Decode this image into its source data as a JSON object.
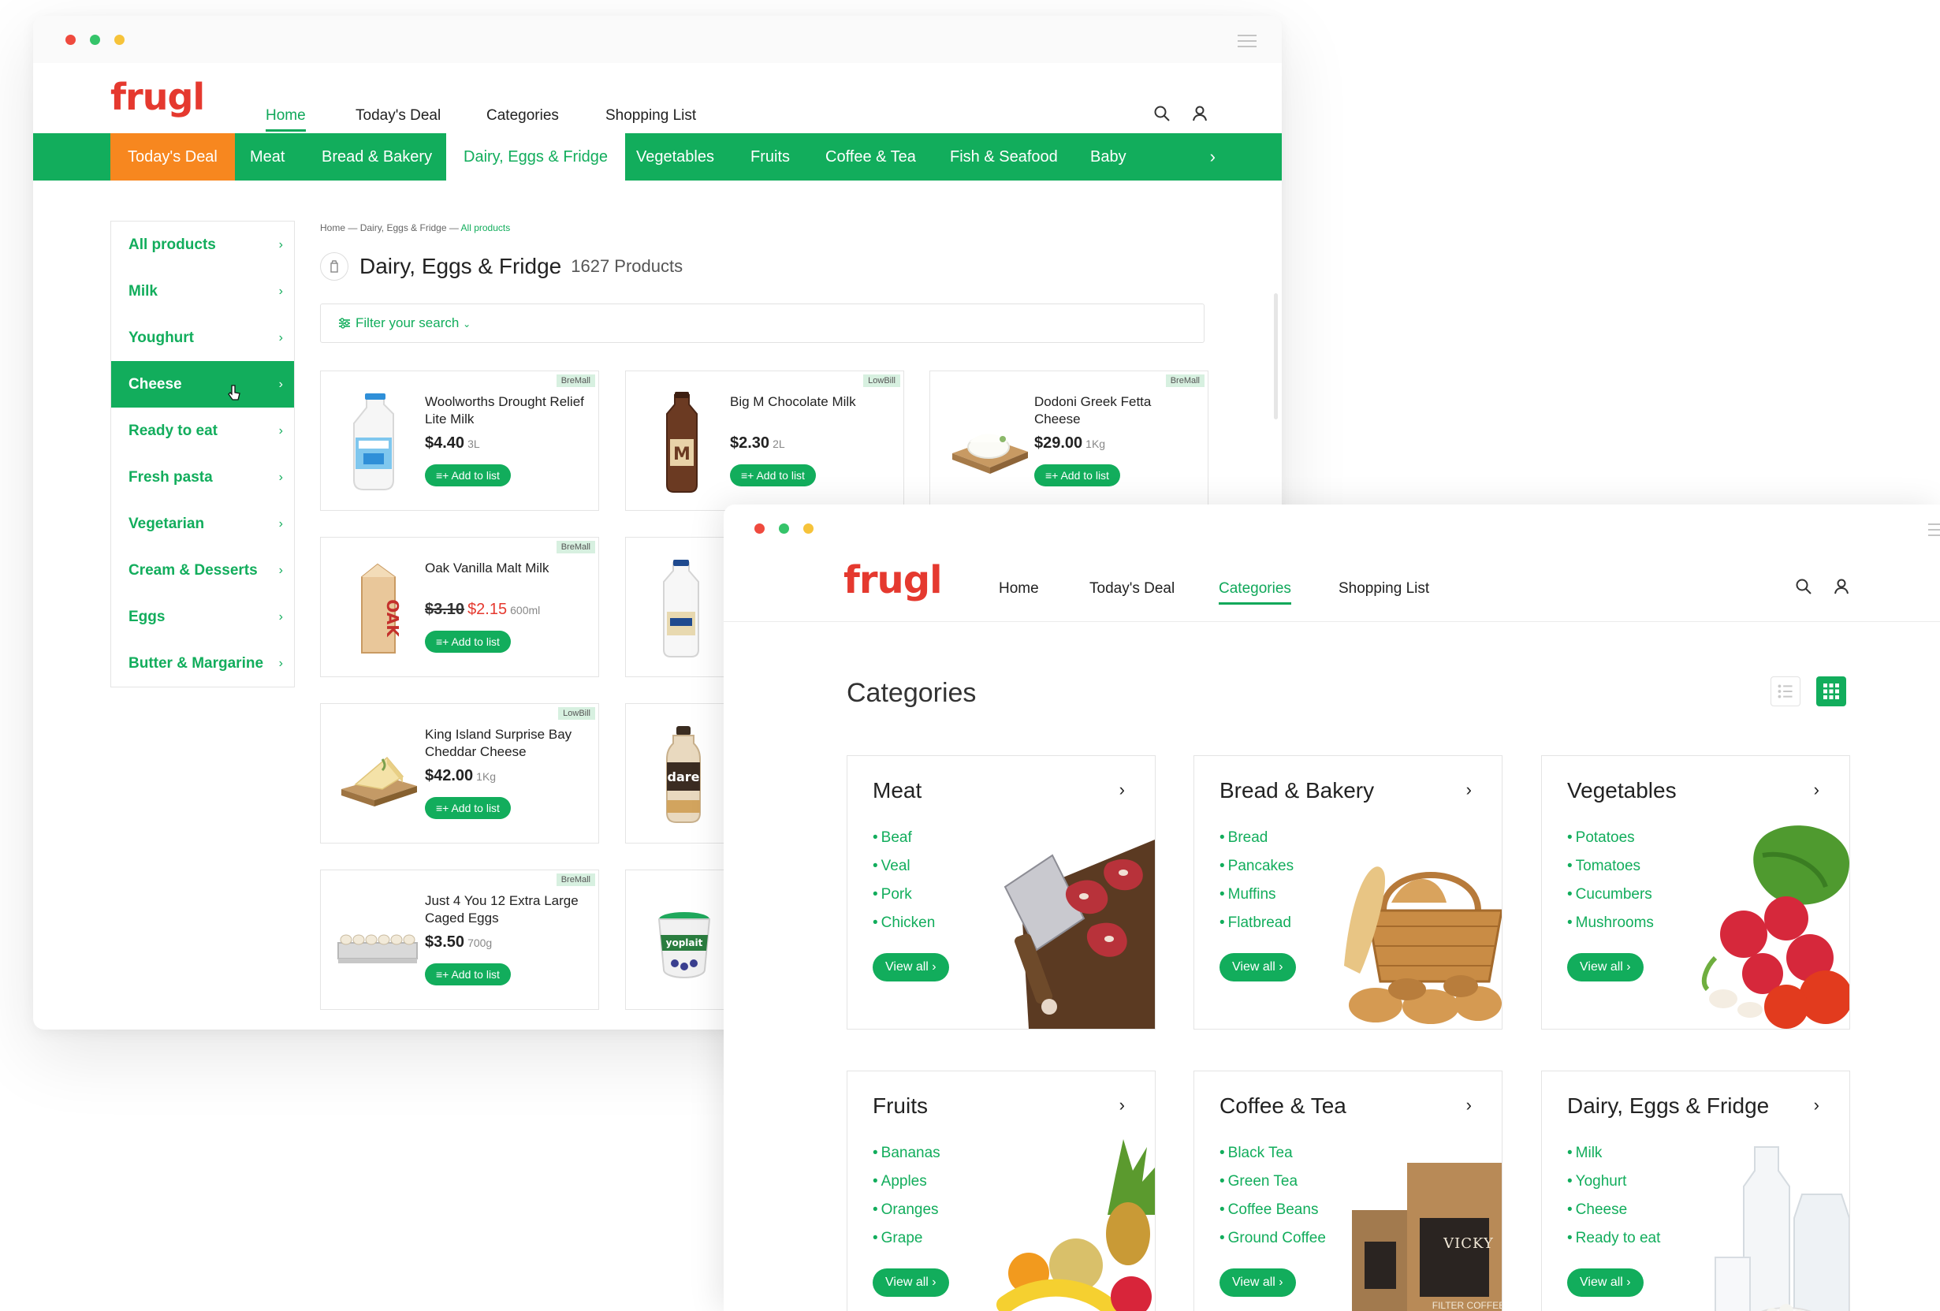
{
  "colors": {
    "brand_green": "#12ad5c",
    "deal_orange": "#f7871f",
    "logo_red": "#e5392f"
  },
  "back_window": {
    "logo": "frugl",
    "nav": [
      {
        "label": "Home",
        "active": true
      },
      {
        "label": "Today's Deal",
        "active": false
      },
      {
        "label": "Categories",
        "active": false
      },
      {
        "label": "Shopping List",
        "active": false
      }
    ],
    "category_bar": [
      {
        "label": "Today's Deal"
      },
      {
        "label": "Meat"
      },
      {
        "label": "Bread & Bakery"
      },
      {
        "label": "Dairy, Eggs & Fridge"
      },
      {
        "label": "Vegetables"
      },
      {
        "label": "Fruits"
      },
      {
        "label": "Coffee & Tea"
      },
      {
        "label": "Fish & Seafood"
      },
      {
        "label": "Baby"
      }
    ],
    "category_more": "›",
    "sidebar": [
      {
        "label": "All products"
      },
      {
        "label": "Milk"
      },
      {
        "label": "Youghurt"
      },
      {
        "label": "Cheese"
      },
      {
        "label": "Ready to eat"
      },
      {
        "label": "Fresh pasta"
      },
      {
        "label": "Vegetarian"
      },
      {
        "label": "Cream & Desserts"
      },
      {
        "label": "Eggs"
      },
      {
        "label": "Butter & Margarine"
      }
    ],
    "breadcrumb": {
      "home": "Home",
      "sep1": " — ",
      "section": "Dairy, Eggs & Fridge",
      "sep2": " — ",
      "current": "All products"
    },
    "page_title": "Dairy, Eggs & Fridge",
    "product_count": "1627 Products",
    "filter_label": "Filter your search",
    "add_label": "Add to list",
    "products": [
      {
        "tag": "BreMall",
        "name": "Woolworths Drought Relief Lite Milk",
        "price": "$4.40",
        "unit": "3L"
      },
      {
        "tag": "LowBill",
        "name": "Big M Chocolate Milk",
        "price": "$2.30",
        "unit": "2L"
      },
      {
        "tag": "BreMall",
        "name": "Dodoni Greek Fetta Cheese",
        "price": "$29.00",
        "unit": "1Kg"
      },
      {
        "tag": "BreMall",
        "name": "Oak Vanilla Malt Milk",
        "old_price": "$3.10",
        "price": "$2.15",
        "unit": "600ml"
      },
      {
        "tag": "LowBill",
        "name": "King Island Surprise Bay Cheddar Cheese",
        "price": "$42.00",
        "unit": "1Kg"
      },
      {
        "tag": "BreMall",
        "name": "Just 4 You 12 Extra Large Caged Eggs",
        "price": "$3.50",
        "unit": "700g"
      }
    ]
  },
  "front_window": {
    "logo": "frugl",
    "nav": [
      {
        "label": "Home",
        "active": false
      },
      {
        "label": "Today's Deal",
        "active": false
      },
      {
        "label": "Categories",
        "active": true
      },
      {
        "label": "Shopping List",
        "active": false
      }
    ],
    "page_title": "Categories",
    "view_all_label": "View all ›",
    "categories": [
      {
        "title": "Meat",
        "items": [
          "Beaf",
          "Veal",
          "Pork",
          "Chicken"
        ]
      },
      {
        "title": "Bread & Bakery",
        "items": [
          "Bread",
          "Pancakes",
          "Muffins",
          "Flatbread"
        ]
      },
      {
        "title": "Vegetables",
        "items": [
          "Potatoes",
          "Tomatoes",
          "Cucumbers",
          "Mushrooms"
        ]
      },
      {
        "title": "Fruits",
        "items": [
          "Bananas",
          "Apples",
          "Oranges",
          "Grape"
        ]
      },
      {
        "title": "Coffee & Tea",
        "items": [
          "Black Tea",
          "Green Tea",
          "Coffee Beans",
          "Ground Coffee"
        ]
      },
      {
        "title": "Dairy, Eggs & Fridge",
        "items": [
          "Milk",
          "Yoghurt",
          "Cheese",
          "Ready to eat"
        ]
      }
    ],
    "coffee_bag_label": "VICKY",
    "coffee_bag_sub": "FILTER COFFEE"
  }
}
